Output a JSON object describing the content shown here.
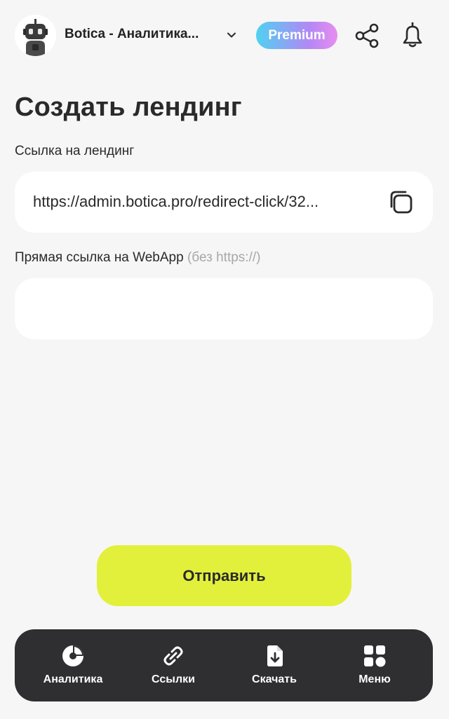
{
  "header": {
    "app_title": "Botica - Аналитика...",
    "premium_label": "Premium"
  },
  "main": {
    "title": "Создать лендинг",
    "landing_link": {
      "label": "Ссылка на лендинг",
      "value": "https://admin.botica.pro/redirect-click/32..."
    },
    "webapp_link": {
      "label": "Прямая ссылка на WebApp",
      "hint": "(без https://)",
      "value": "",
      "placeholder": ""
    },
    "submit_label": "Отправить"
  },
  "bottom_nav": {
    "items": [
      {
        "label": "Аналитика",
        "icon": "pie-chart-icon"
      },
      {
        "label": "Ссылки",
        "icon": "link-icon"
      },
      {
        "label": "Скачать",
        "icon": "download-file-icon"
      },
      {
        "label": "Меню",
        "icon": "grid-menu-icon"
      }
    ]
  },
  "colors": {
    "background": "#f6f6f6",
    "accent_button": "#e2f03c",
    "nav_background": "#2f2e30",
    "premium_gradient": [
      "#4fd1f1",
      "#b388f4",
      "#e88df0"
    ]
  }
}
